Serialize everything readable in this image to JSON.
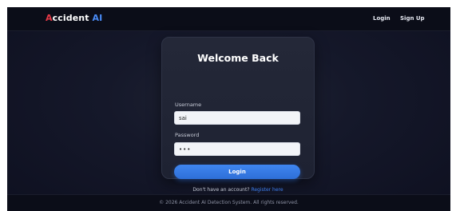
{
  "brand": {
    "first_letter": "A",
    "rest": "ccident ",
    "accent_word": "AI",
    "colors": {
      "first_letter": "#e63946",
      "accent_word": "#4a8cf7"
    }
  },
  "nav": {
    "login_label": "Login",
    "signup_label": "Sign Up"
  },
  "login_card": {
    "title": "Welcome Back",
    "username": {
      "label": "Username",
      "value": "sai"
    },
    "password": {
      "label": "Password",
      "value": "•••"
    },
    "submit_label": "Login",
    "signup_prompt": "Don't have an account?",
    "signup_link": "Register here"
  },
  "footer": {
    "text": "© 2026 Accident AI Detection System. All rights reserved."
  },
  "theme": {
    "background": "#15182a",
    "card": "#242838",
    "primary": "#3f86f0"
  }
}
